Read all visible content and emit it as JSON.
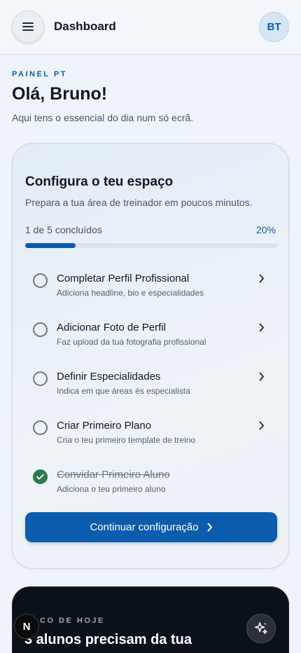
{
  "header": {
    "title": "Dashboard",
    "avatar_initials": "BT",
    "menu_icon": "hamburger-menu-icon"
  },
  "intro": {
    "eyebrow": "PAINEL PT",
    "greeting": "Olá, Bruno!",
    "subtitle": "Aqui tens o essencial do dia num só ecrã."
  },
  "setup": {
    "title": "Configura o teu espaço",
    "description": "Prepara a tua área de treinador em poucos minutos.",
    "progress_text": "1 de 5 concluídos",
    "progress_percent_label": "20%",
    "progress_fraction": 0.2,
    "tasks": [
      {
        "title": "Completar Perfil Profissional",
        "subtitle": "Adiciona headline, bio e especialidades",
        "done": false
      },
      {
        "title": "Adicionar Foto de Perfil",
        "subtitle": "Faz upload da tua fotografia profissional",
        "done": false
      },
      {
        "title": "Definir Especialidades",
        "subtitle": "Indica em que áreas és especialista",
        "done": false
      },
      {
        "title": "Criar Primeiro Plano",
        "subtitle": "Cria o teu primeiro template de treino",
        "done": false
      },
      {
        "title": "Convidar Primeiro Aluno",
        "subtitle": "Adiciona o teu primeiro aluno",
        "done": true
      }
    ],
    "continue_label": "Continuar configuração"
  },
  "focus": {
    "eyebrow": "CO DE HOJE",
    "title": "3 alunos precisam da tua"
  },
  "floating": {
    "n_badge": "N",
    "sparkle_icon": "sparkle-icon"
  },
  "colors": {
    "accent": "#0b5cad",
    "done_green": "#2d7a4e",
    "dark_card": "#0b1118"
  }
}
